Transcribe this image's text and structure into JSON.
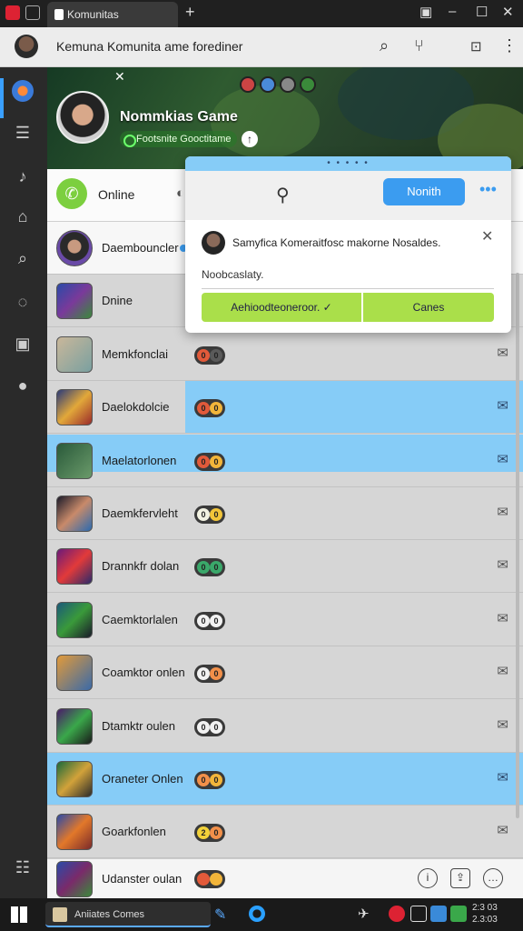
{
  "window": {
    "tab_title": "Komunitas",
    "new_tab": "+",
    "controls": {
      "minimize": "–",
      "maximize": "☐",
      "close": "✕"
    }
  },
  "header": {
    "title": "Kemuna Komunita ame forediner"
  },
  "banner": {
    "game_name": "Nommkias Game",
    "subtitle": "Footsnite Gooctitame"
  },
  "online": {
    "label": "Online"
  },
  "dialog": {
    "top_label": "• • • • •",
    "primary_button": "Nonith",
    "message": "Samyfica Komeraitfosc makorne Nosaldes.",
    "field_value": "Noobcaslaty.",
    "accept_button": "Aehioodteoneroor. ✓",
    "cancel_button": "Canes"
  },
  "rows": [
    {
      "name": "Daembouncler",
      "style": "white",
      "badge": []
    },
    {
      "name": "Dnine",
      "style": "plain",
      "badge": []
    },
    {
      "name": "Memkfonclai",
      "style": "plain",
      "badge": [
        "0",
        "0"
      ]
    },
    {
      "name": "Daelokdolcie",
      "style": "hl",
      "badge": [
        "0",
        "0"
      ]
    },
    {
      "name": "Maelatorlonen",
      "style": "hl2",
      "badge": [
        "0",
        "0"
      ]
    },
    {
      "name": "Daemkfervleht",
      "style": "plain",
      "badge": [
        "0",
        "0"
      ]
    },
    {
      "name": "Drannkfr dolan",
      "style": "plain",
      "badge": [
        "0",
        "0"
      ]
    },
    {
      "name": "Caemktorlalen",
      "style": "plain",
      "badge": [
        "0",
        "0"
      ]
    },
    {
      "name": "Coamktor onlen",
      "style": "plain",
      "badge": [
        "0",
        "0"
      ]
    },
    {
      "name": "Dtamktr oulen",
      "style": "plain",
      "badge": [
        "0",
        "0"
      ]
    },
    {
      "name": "Oraneter Onlen",
      "style": "hl3",
      "badge": [
        "0",
        "0"
      ]
    },
    {
      "name": "Goarkfonlen",
      "style": "plain",
      "badge": [
        "2",
        "0"
      ]
    }
  ],
  "bottom_row": {
    "name": "Udanster oulan"
  },
  "taskbar": {
    "app_label": "Aniiates Comes",
    "clock_time": "2:3 03",
    "clock_date": "2.3:03"
  },
  "colors": {
    "accent_blue": "#86ccf7",
    "button_blue": "#3b9cf0",
    "online_green": "#7ccf3f",
    "accept_green": "#aadf4a"
  },
  "icons": {
    "rail": [
      "globe-icon",
      "grid-icon",
      "music-icon",
      "tag-icon",
      "search-icon",
      "chat-icon",
      "calendar-icon",
      "bubble-icon"
    ]
  }
}
